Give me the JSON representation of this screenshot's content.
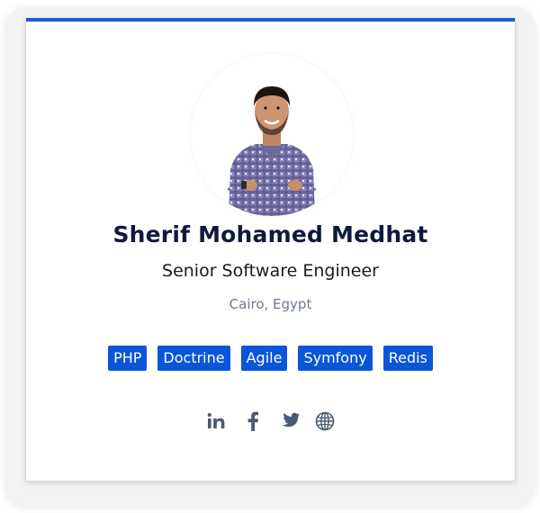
{
  "profile": {
    "name": "Sherif Mohamed Medhat",
    "title": "Senior Software Engineer",
    "location": "Cairo, Egypt"
  },
  "tags": [
    "PHP",
    "Doctrine",
    "Agile",
    "Symfony",
    "Redis"
  ],
  "socials": [
    {
      "name": "linkedin-icon"
    },
    {
      "name": "facebook-icon"
    },
    {
      "name": "twitter-icon"
    },
    {
      "name": "globe-icon"
    }
  ],
  "colors": {
    "accent": "#1f5bd8",
    "tag_bg": "#0a56d6",
    "name_text": "#0f1a3a",
    "location_text": "#6e7a90",
    "icon": "#4b5a70"
  }
}
